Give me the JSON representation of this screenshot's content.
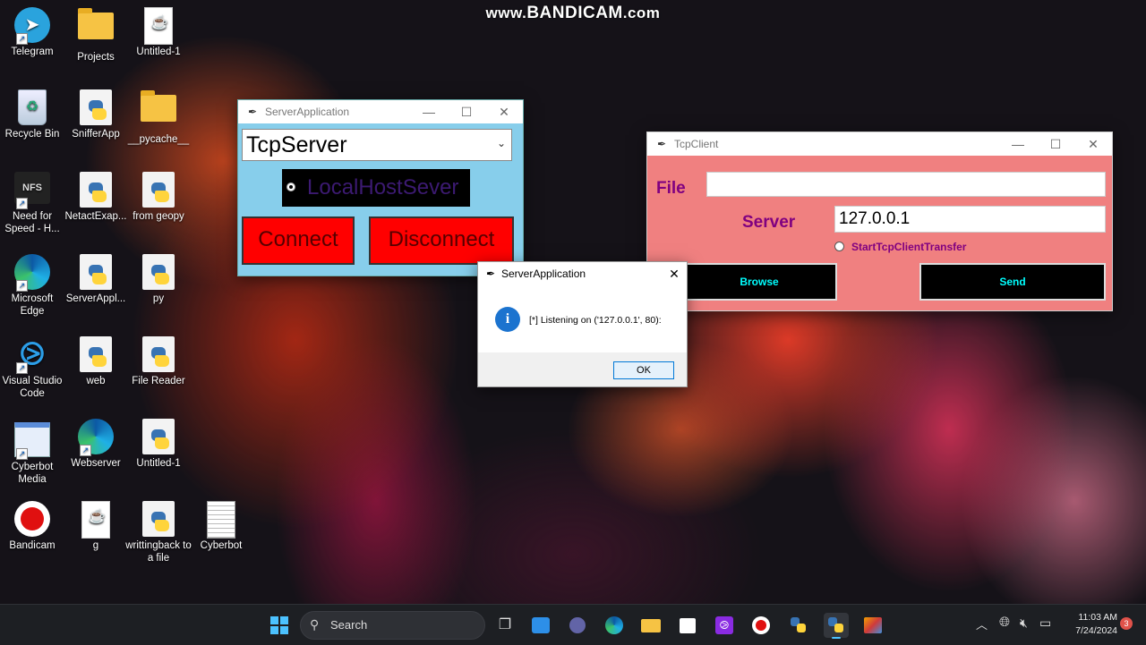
{
  "watermark": {
    "prefix": "www.",
    "brand": "BANDICAM",
    "suffix": ".com"
  },
  "desktop_icons": [
    {
      "label": "Telegram"
    },
    {
      "label": "Projects"
    },
    {
      "label": "Untitled-1"
    },
    {
      "label": "Recycle Bin"
    },
    {
      "label": "SnifferApp"
    },
    {
      "label": "__pycache__"
    },
    {
      "label": "Need for Speed - H..."
    },
    {
      "label": "NetactExap..."
    },
    {
      "label": "from geopy"
    },
    {
      "label": "Microsoft Edge"
    },
    {
      "label": "ServerAppl..."
    },
    {
      "label": "py"
    },
    {
      "label": "Visual Studio Code"
    },
    {
      "label": "web"
    },
    {
      "label": "File Reader"
    },
    {
      "label": "Cyberbot Media"
    },
    {
      "label": "Webserver"
    },
    {
      "label": "Untitled-1"
    },
    {
      "label": "Bandicam"
    },
    {
      "label": "g"
    },
    {
      "label": "writtingback to a file"
    },
    {
      "label": "Cyberbot"
    }
  ],
  "server_window": {
    "title": "ServerApplication",
    "select_value": "TcpServer",
    "radio_label": "LocalHostSever",
    "connect_label": "Connect",
    "disconnect_label": "Disconnect"
  },
  "client_window": {
    "title": "TcpClient",
    "file_label": "File",
    "file_value": "",
    "server_label": "Server",
    "server_value": "127.0.0.1",
    "radio_label": "StartTcpClientTransfer",
    "browse_label": "Browse",
    "send_label": "Send"
  },
  "dialog": {
    "title": "ServerApplication",
    "message": "[*] Listening on ('127.0.0.1', 80):",
    "ok_label": "OK"
  },
  "taskbar": {
    "search_placeholder": "Search",
    "time": "11:03 AM",
    "date": "7/24/2024",
    "notification_count": "3"
  },
  "colors": {
    "server_bg": "#87ceeb",
    "client_bg": "#f08080",
    "button_red": "#ff0000",
    "client_label": "#800080",
    "send_text": "#00ffff"
  }
}
